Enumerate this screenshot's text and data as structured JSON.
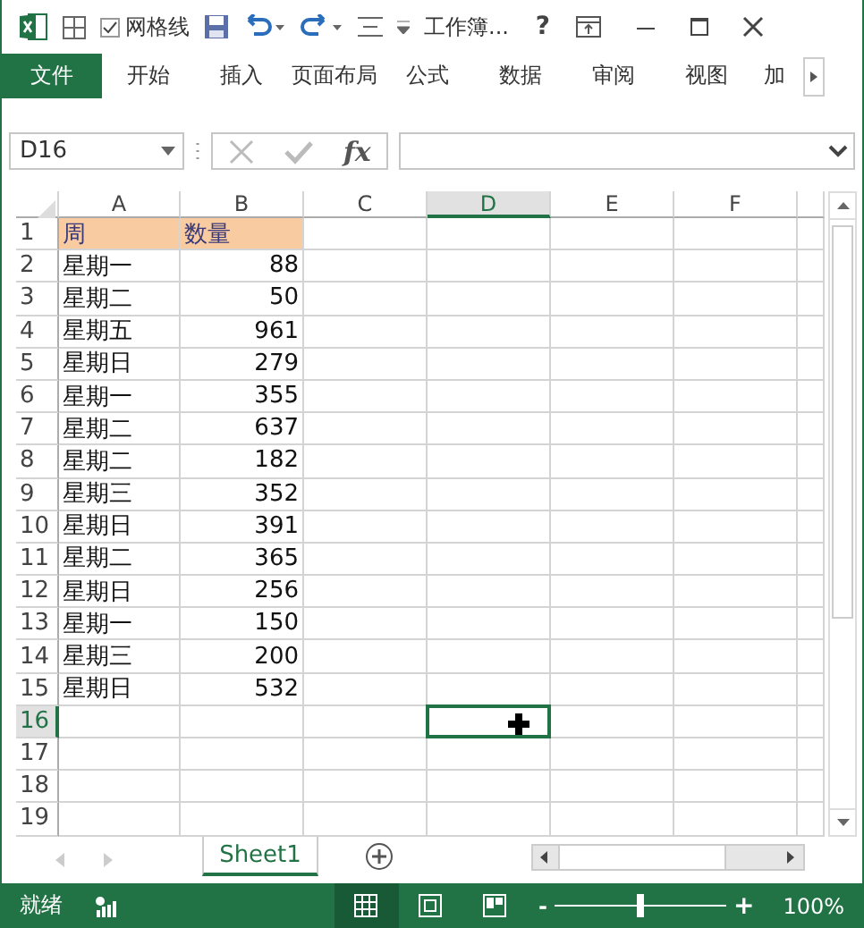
{
  "title_bar": {
    "gridlines": {
      "label": "网格线",
      "checked": true
    },
    "title": "工作簿...",
    "help": "?"
  },
  "ribbon_tabs": [
    {
      "label": "文件",
      "kind": "file"
    },
    {
      "label": "开始",
      "kind": "tab"
    },
    {
      "label": "插入",
      "kind": "tab"
    },
    {
      "label": "页面布局",
      "kind": "tab"
    },
    {
      "label": "公式",
      "kind": "tab"
    },
    {
      "label": "数据",
      "kind": "tab"
    },
    {
      "label": "审阅",
      "kind": "tab"
    },
    {
      "label": "视图",
      "kind": "tab"
    },
    {
      "label": "加",
      "kind": "tab"
    }
  ],
  "formula_bar": {
    "name_box": "D16",
    "fx": "fx"
  },
  "columns": [
    {
      "label": "A",
      "selected": false
    },
    {
      "label": "B",
      "selected": false
    },
    {
      "label": "C",
      "selected": false
    },
    {
      "label": "D",
      "selected": true
    },
    {
      "label": "E",
      "selected": false
    },
    {
      "label": "F",
      "selected": false
    }
  ],
  "rows": [
    {
      "number": "1",
      "selected": false,
      "kind": "header",
      "a": "周",
      "b": "数量"
    },
    {
      "number": "2",
      "selected": false,
      "kind": "data",
      "a": "星期一",
      "b": "88"
    },
    {
      "number": "3",
      "selected": false,
      "kind": "data",
      "a": "星期二",
      "b": "50"
    },
    {
      "number": "4",
      "selected": false,
      "kind": "data",
      "a": "星期五",
      "b": "961"
    },
    {
      "number": "5",
      "selected": false,
      "kind": "data",
      "a": "星期日",
      "b": "279"
    },
    {
      "number": "6",
      "selected": false,
      "kind": "data",
      "a": "星期一",
      "b": "355"
    },
    {
      "number": "7",
      "selected": false,
      "kind": "data",
      "a": "星期二",
      "b": "637"
    },
    {
      "number": "8",
      "selected": false,
      "kind": "data",
      "a": "星期二",
      "b": "182"
    },
    {
      "number": "9",
      "selected": false,
      "kind": "data",
      "a": "星期三",
      "b": "352"
    },
    {
      "number": "10",
      "selected": false,
      "kind": "data",
      "a": "星期日",
      "b": "391"
    },
    {
      "number": "11",
      "selected": false,
      "kind": "data",
      "a": "星期二",
      "b": "365"
    },
    {
      "number": "12",
      "selected": false,
      "kind": "data",
      "a": "星期日",
      "b": "256"
    },
    {
      "number": "13",
      "selected": false,
      "kind": "data",
      "a": "星期一",
      "b": "150"
    },
    {
      "number": "14",
      "selected": false,
      "kind": "data",
      "a": "星期三",
      "b": "200"
    },
    {
      "number": "15",
      "selected": false,
      "kind": "data",
      "a": "星期日",
      "b": "532"
    },
    {
      "number": "16",
      "selected": true,
      "kind": "empty"
    },
    {
      "number": "17",
      "selected": false,
      "kind": "empty"
    },
    {
      "number": "18",
      "selected": false,
      "kind": "empty"
    },
    {
      "number": "19",
      "selected": false,
      "kind": "empty"
    }
  ],
  "sheet_tabs": [
    {
      "label": "Sheet1",
      "selected": true
    }
  ],
  "status_bar": {
    "status": "就绪",
    "views": [
      {
        "kind": "normal",
        "selected": true
      },
      {
        "kind": "layout",
        "selected": false
      },
      {
        "kind": "pagebreak",
        "selected": false
      }
    ],
    "zoom": {
      "minus": "-",
      "plus": "+",
      "level": 0.5,
      "reading": "100%"
    }
  }
}
